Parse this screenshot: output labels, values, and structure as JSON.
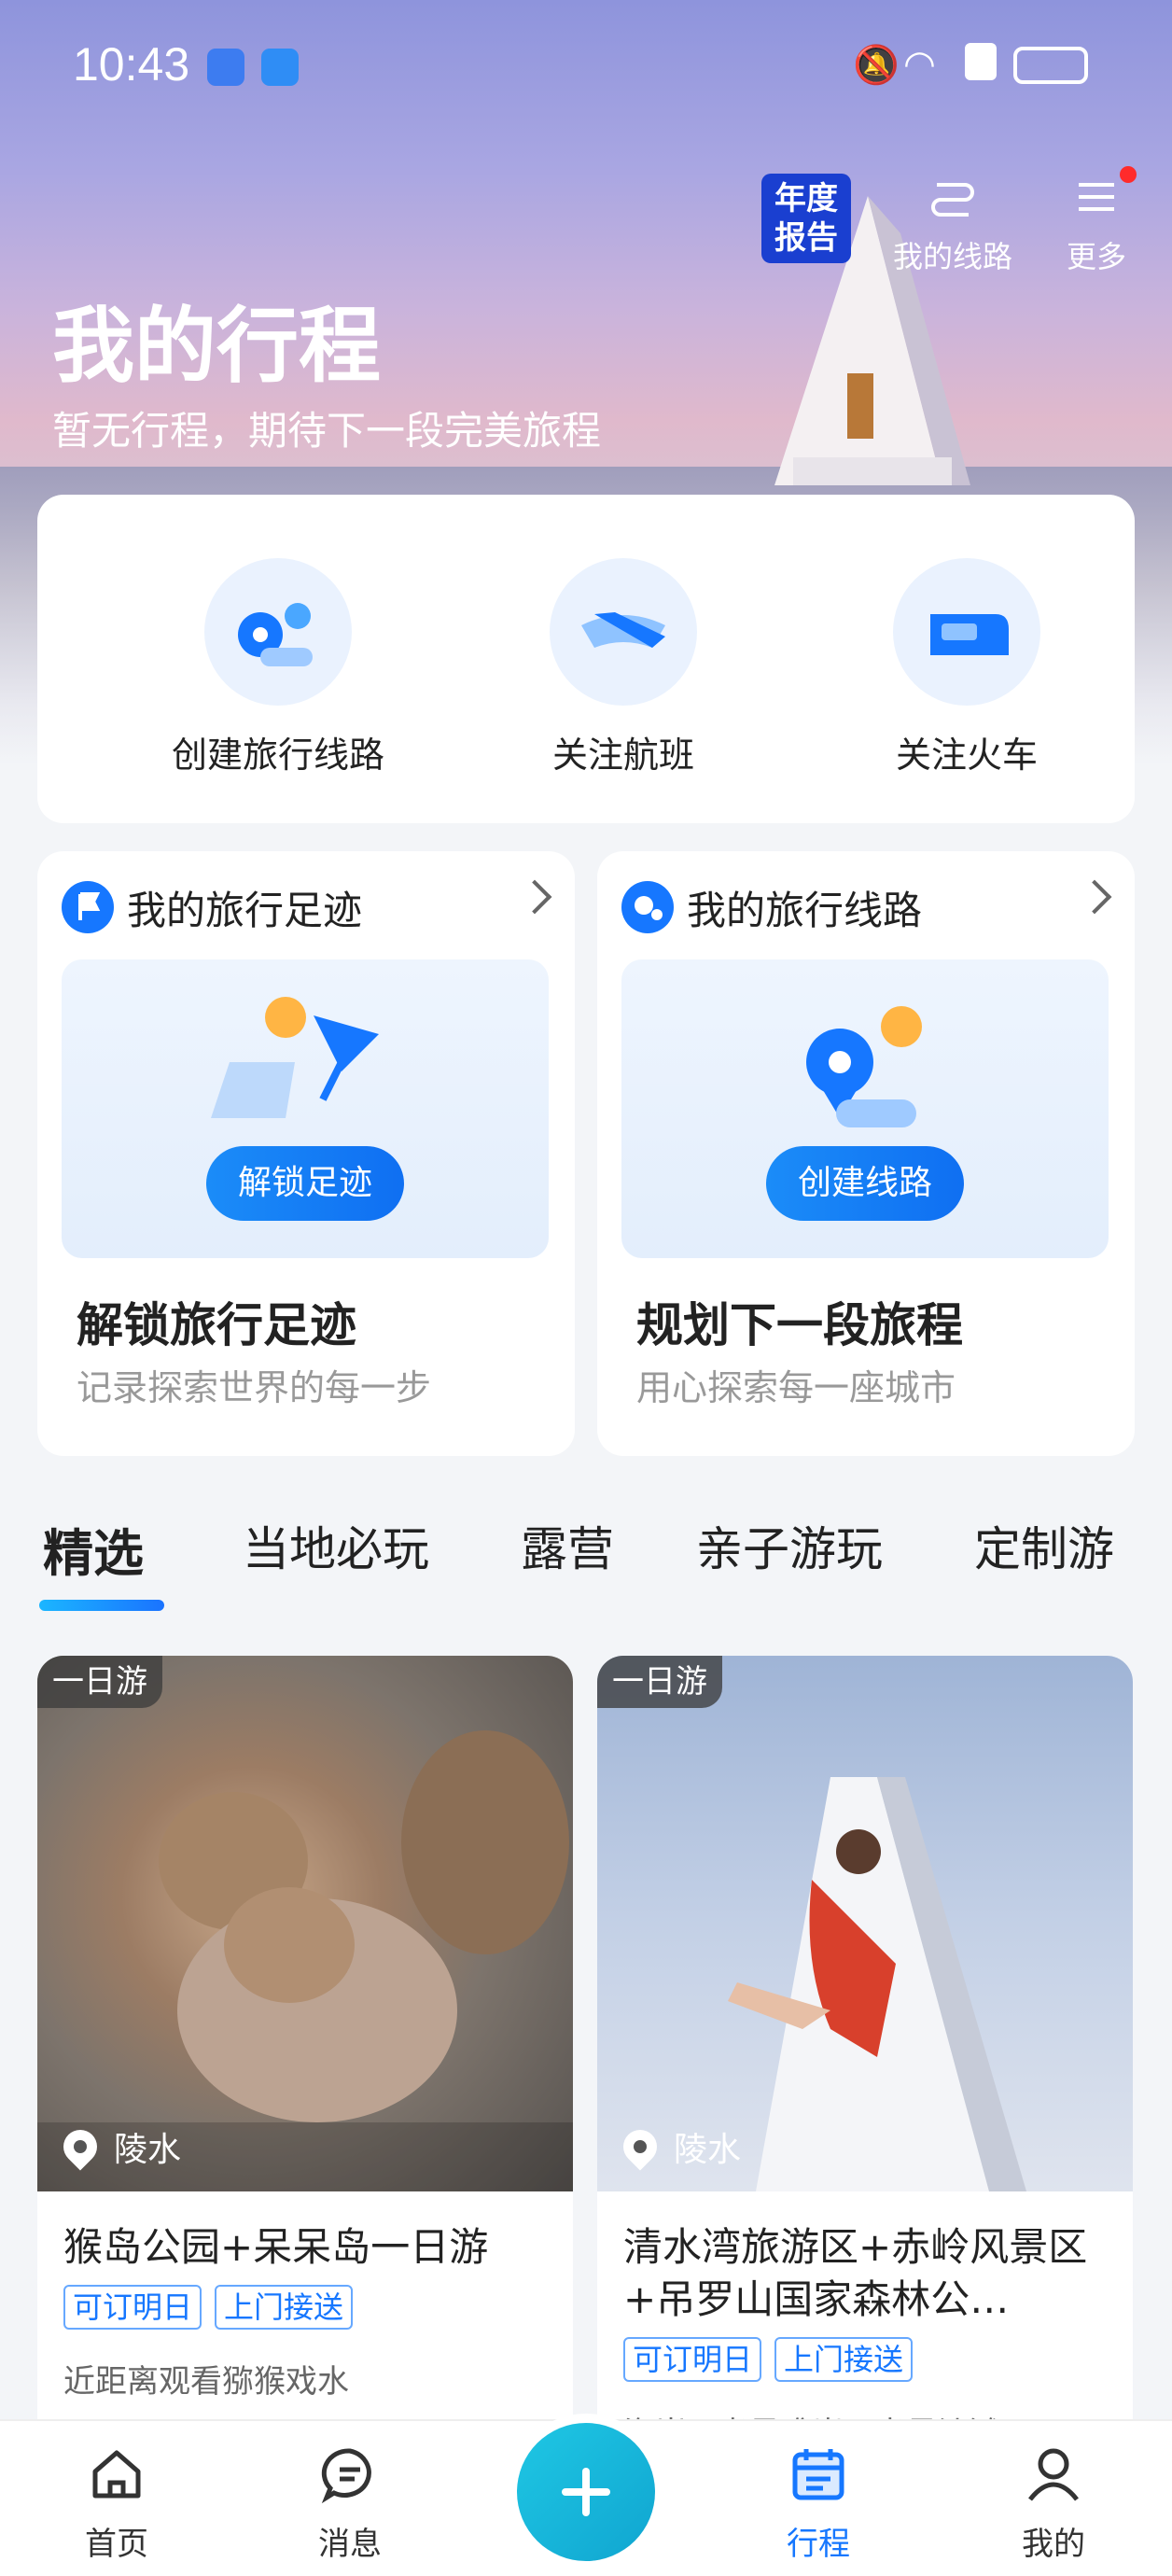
{
  "status_bar": {
    "time": "10:43"
  },
  "header": {
    "report_badge": "年度\n报告",
    "report_line1": "年度",
    "report_line2": "报告",
    "my_routes": "我的线路",
    "more": "更多",
    "title": "我的行程",
    "subtitle": "暂无行程，期待下一段完美旅程"
  },
  "quick_actions": [
    {
      "label": "创建旅行线路",
      "icon": "route-pin-icon"
    },
    {
      "label": "关注航班",
      "icon": "plane-icon"
    },
    {
      "label": "关注火车",
      "icon": "train-icon"
    }
  ],
  "features": {
    "footprint": {
      "heading": "我的旅行足迹",
      "button": "解锁足迹",
      "title": "解锁旅行足迹",
      "subtitle": "记录探索世界的每一步"
    },
    "routes": {
      "heading": "我的旅行线路",
      "button": "创建线路",
      "title": "规划下一段旅程",
      "subtitle": "用心探索每一座城市"
    }
  },
  "tabs": [
    "精选",
    "当地必玩",
    "露营",
    "亲子游玩",
    "定制游"
  ],
  "products": [
    {
      "tag": "一日游",
      "location": "陵水",
      "title": "猴岛公园+呆呆岛一日游",
      "chips": [
        "可订明日",
        "上门接送"
      ],
      "desc": "近距离观看猕猴戏水"
    },
    {
      "tag": "一日游",
      "location": "陵水",
      "title": "清水湾旅游区+赤岭风景区+吊罗山国家森林公…",
      "chips": [
        "可订明日",
        "上门接送"
      ],
      "desc": "海岸 · 米量礁岩 · 米量沙滩"
    }
  ],
  "bottom_nav": {
    "home": "首页",
    "messages": "消息",
    "trips": "行程",
    "mine": "我的"
  },
  "colors": {
    "accent": "#1677ff",
    "fab": "#1fb5da"
  }
}
